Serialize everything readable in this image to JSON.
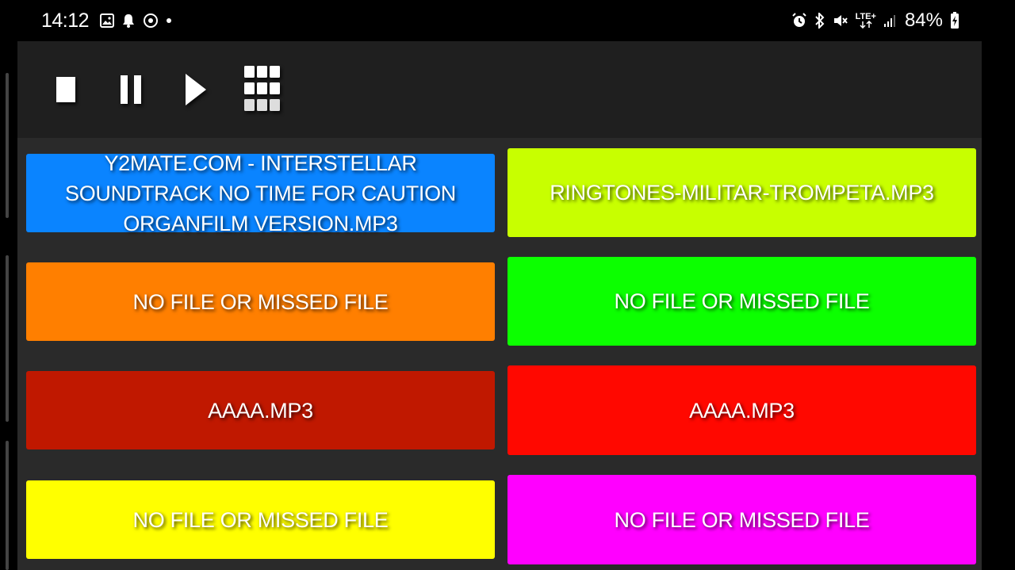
{
  "status_bar": {
    "time": "14:12",
    "battery": "84%",
    "network": "LTE+",
    "left_icons": [
      "image-icon",
      "bell-icon",
      "sync-icon",
      "dot-icon"
    ],
    "right_icons": [
      "alarm-icon",
      "bluetooth-icon",
      "mute-icon",
      "lte-icon",
      "signal-icon",
      "battery-icon"
    ]
  },
  "toolbar": {
    "buttons": [
      {
        "name": "stop-icon"
      },
      {
        "name": "pause-icon"
      },
      {
        "name": "play-icon"
      },
      {
        "name": "grid-icon"
      }
    ]
  },
  "pads": [
    {
      "label": "Y2MATE.COM - INTERSTELLAR SOUNDTRACK  NO TIME FOR CAUTION ORGANFILM VERSION.MP3",
      "color": "#0a84ff"
    },
    {
      "label": "RINGTONES-MILITAR-TROMPETA.MP3",
      "color": "#c8ff00"
    },
    {
      "label": "NO FILE OR MISSED FILE",
      "color": "#ff7f00"
    },
    {
      "label": "NO FILE OR MISSED FILE",
      "color": "#0cff00"
    },
    {
      "label": "AAAA.MP3",
      "color": "#c01800"
    },
    {
      "label": "AAAA.MP3",
      "color": "#ff0800"
    },
    {
      "label": "NO FILE OR MISSED FILE",
      "color": "#ffff00"
    },
    {
      "label": "NO FILE OR MISSED FILE",
      "color": "#ff00ff"
    }
  ]
}
